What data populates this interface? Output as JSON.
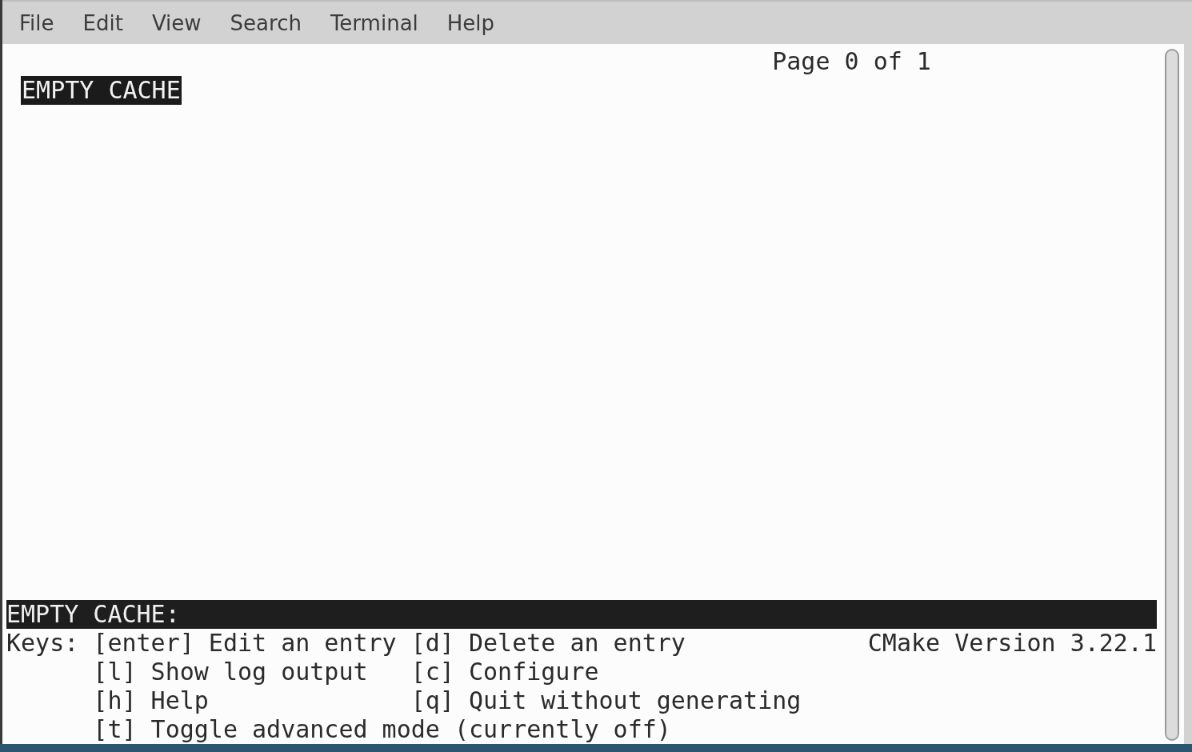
{
  "menu": [
    "File",
    "Edit",
    "View",
    "Search",
    "Terminal",
    "Help"
  ],
  "page_indicator": "Page 0 of 1",
  "entries": [
    {
      "label": "EMPTY CACHE",
      "selected": true
    }
  ],
  "status_line": "EMPTY CACHE:",
  "keys_label": "Keys:",
  "key_rows": [
    [
      "[enter] Edit an entry",
      "[d] Delete an entry"
    ],
    [
      "[l] Show log output",
      "[c] Configure"
    ],
    [
      "[h] Help",
      "[q] Quit without generating"
    ],
    [
      "[t] Toggle advanced mode (currently off)"
    ]
  ],
  "version": "CMake Version 3.22.1"
}
